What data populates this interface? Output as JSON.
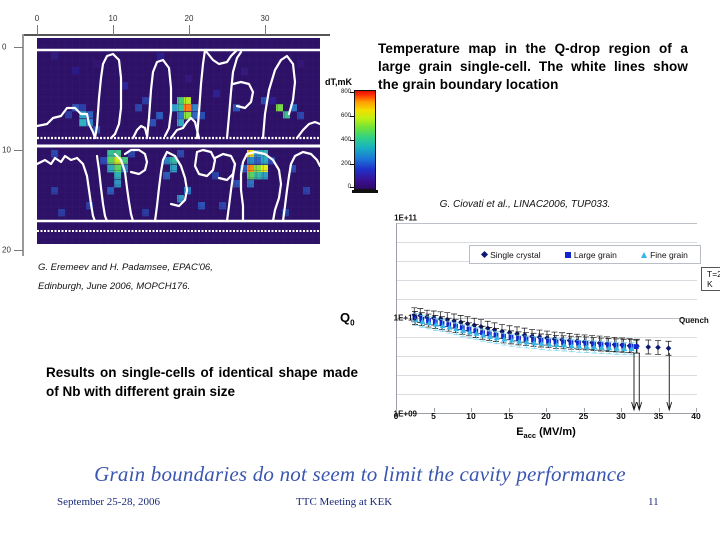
{
  "temperature_map": {
    "colorbar": {
      "title": "dT,mK",
      "ticks": [
        "800",
        "600",
        "400",
        "200",
        "0"
      ],
      "min": 0,
      "max": 800,
      "unit": "mK"
    },
    "x_axis": {
      "ticks": [
        "0",
        "10",
        "20",
        "30"
      ]
    },
    "y_axis": {
      "ticks": [
        "0",
        "10",
        "20"
      ]
    },
    "overlay_line_color": "#ffffff",
    "background_color": "#2b1060"
  },
  "description": {
    "text": "Temperature map in the Q-drop region of a large grain single-cell. The white lines show the grain boundary location"
  },
  "citation_right": "G. Ciovati et al., LINAC2006, TUP033.",
  "citation_left_line1": "G. Eremeev and H. Padamsee, EPAC'06,",
  "citation_left_line2": "Edinburgh, June 2006, MOPCH176.",
  "results_text": "Results on single-cells of identical shape made of Nb with different grain size",
  "footer": {
    "headline": "Grain boundaries do not seem to limit the cavity performance",
    "date": "September 25-28, 2006",
    "meeting": "TTC Meeting at KEK",
    "page_number": "11",
    "headline_color": "#3a56b0"
  },
  "chart_data": {
    "type": "scatter",
    "title": "",
    "xlabel": "Eacc (MV/m)",
    "xlabel_main": "E",
    "xlabel_sub": "acc",
    "xlabel_unit": " (MV/m)",
    "ylabel": "Q0",
    "ylabel_main": "Q",
    "ylabel_sub": "0",
    "x_ticks": [
      "0",
      "5",
      "10",
      "15",
      "20",
      "25",
      "30",
      "35",
      "40"
    ],
    "y_ticks": [
      "1E+11",
      "1E+10",
      "1E+09"
    ],
    "xlim": [
      0,
      40
    ],
    "ylim": [
      1000000000.0,
      100000000000.0
    ],
    "yscale": "log",
    "grid": true,
    "legend_position": "top-center",
    "annotations": [
      {
        "label": "Quench",
        "x": 33
      },
      {
        "label": "T=2 K",
        "x": 37
      }
    ],
    "series": [
      {
        "name": "Single crystal",
        "color": "#0e1a70",
        "marker": "diamond",
        "x": [
          2.3,
          3.1,
          4.0,
          4.9,
          5.8,
          6.7,
          7.6,
          8.5,
          9.4,
          10.3,
          11.2,
          12.1,
          13.0,
          14.0,
          15.0,
          16.0,
          17.0,
          18.0,
          19.0,
          20.0,
          21.0,
          22.0,
          23.0,
          24.0,
          25.0,
          26.0,
          27.0,
          28.0,
          29.0,
          30.0,
          31.0,
          32.0,
          33.5,
          34.8,
          36.2
        ],
        "y": [
          10800000000.0,
          10600000000.0,
          10200000000.0,
          10000000000.0,
          9800000000.0,
          9600000000.0,
          9300000000.0,
          9000000000.0,
          8700000000.0,
          8400000000.0,
          8100000000.0,
          7800000000.0,
          7500000000.0,
          7200000000.0,
          7000000000.0,
          6800000000.0,
          6600000000.0,
          6400000000.0,
          6300000000.0,
          6150000000.0,
          6000000000.0,
          5900000000.0,
          5800000000.0,
          5700000000.0,
          5600000000.0,
          5500000000.0,
          5450000000.0,
          5350000000.0,
          5250000000.0,
          5200000000.0,
          5100000000.0,
          5050000000.0,
          4950000000.0,
          4900000000.0,
          4800000000.0
        ]
      },
      {
        "name": "Large grain",
        "color": "#1226cf",
        "marker": "square",
        "x": [
          2.4,
          3.3,
          4.2,
          5.1,
          6.0,
          6.9,
          7.8,
          8.7,
          9.6,
          10.5,
          11.4,
          12.3,
          13.2,
          14.2,
          15.2,
          16.2,
          17.2,
          18.2,
          19.2,
          20.2,
          21.2,
          22.2,
          23.2,
          24.2,
          25.2,
          26.2,
          27.2,
          28.2,
          29.2,
          30.2,
          31.2,
          31.9
        ],
        "y": [
          10000000000.0,
          9700000000.0,
          9400000000.0,
          9100000000.0,
          8800000000.0,
          8500000000.0,
          8200000000.0,
          7900000000.0,
          7600000000.0,
          7300000000.0,
          7000000000.0,
          6800000000.0,
          6600000000.0,
          6400000000.0,
          6250000000.0,
          6100000000.0,
          6000000000.0,
          5900000000.0,
          5800000000.0,
          5700000000.0,
          5600000000.0,
          5550000000.0,
          5500000000.0,
          5450000000.0,
          5400000000.0,
          5300000000.0,
          5250000000.0,
          5200000000.0,
          5150000000.0,
          5100000000.0,
          5050000000.0,
          5000000000.0
        ]
      },
      {
        "name": "Fine grain",
        "color": "#34b6e8",
        "marker": "triangle",
        "x": [
          2.5,
          3.4,
          4.3,
          5.2,
          6.1,
          7.0,
          7.9,
          8.8,
          9.7,
          10.6,
          11.5,
          12.4,
          13.3,
          14.3,
          15.3,
          16.3,
          17.3,
          18.3,
          19.3,
          20.3,
          21.3,
          22.3,
          23.3,
          24.3,
          25.3,
          26.3,
          27.3,
          28.3,
          29.3,
          30.3,
          31.3
        ],
        "y": [
          9600000000.0,
          9200000000.0,
          8900000000.0,
          8600000000.0,
          8300000000.0,
          8000000000.0,
          7700000000.0,
          7400000000.0,
          7100000000.0,
          6900000000.0,
          6600000000.0,
          6400000000.0,
          6200000000.0,
          6000000000.0,
          5850000000.0,
          5700000000.0,
          5600000000.0,
          5500000000.0,
          5400000000.0,
          5300000000.0,
          5250000000.0,
          5200000000.0,
          5100000000.0,
          5050000000.0,
          5000000000.0,
          4950000000.0,
          4900000000.0,
          4850000000.0,
          4800000000.0,
          4780000000.0,
          4750000000.0
        ]
      }
    ]
  }
}
